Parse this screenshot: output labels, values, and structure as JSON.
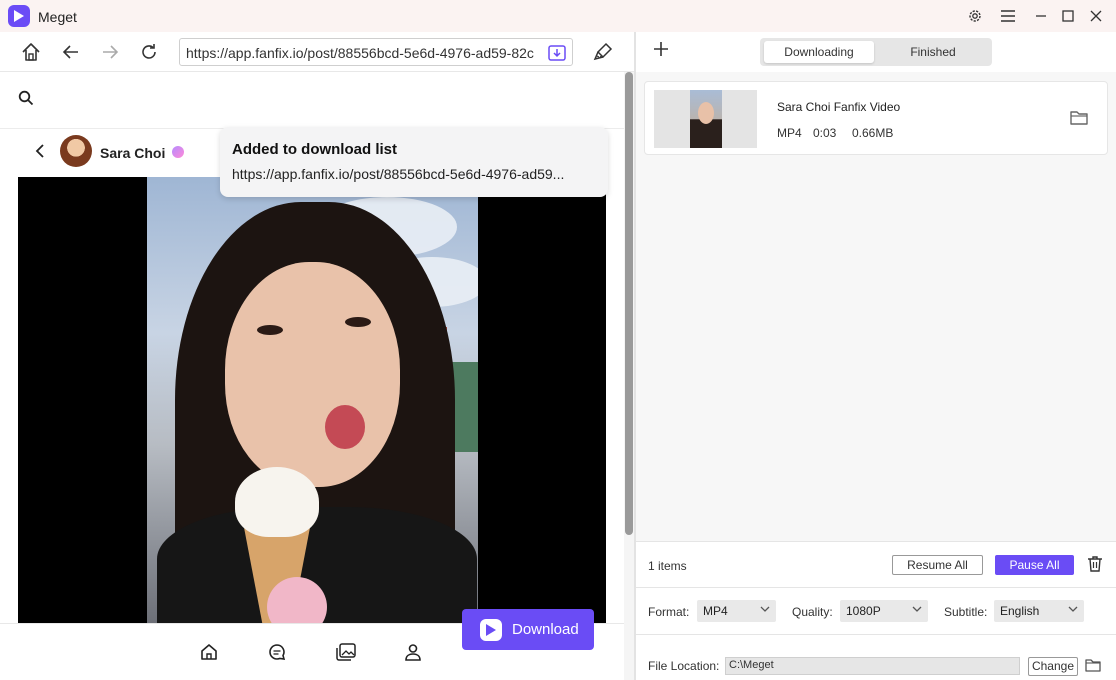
{
  "app": {
    "title": "Meget",
    "accent": "#6a4cf5"
  },
  "window_controls": {
    "settings_icon": "gear-icon",
    "menu_icon": "hamburger-icon",
    "minimize_icon": "minimize-icon",
    "maximize_icon": "maximize-icon",
    "close_icon": "close-icon"
  },
  "browser": {
    "url": "https://app.fanfix.io/post/88556bcd-5e6d-4976-ad59-82c"
  },
  "page": {
    "profile_name": "Sara Choi",
    "download_button": "Download"
  },
  "toast": {
    "title": "Added to download list",
    "url": "https://app.fanfix.io/post/88556bcd-5e6d-4976-ad59..."
  },
  "downloader": {
    "tabs": [
      "Downloading",
      "Finished"
    ],
    "active_tab": "Downloading",
    "item": {
      "title": "Sara Choi Fanfix Video",
      "format": "MP4",
      "duration": "0:03",
      "size": "0.66MB"
    },
    "footer": {
      "items_count": "1 items",
      "resume_all": "Resume All",
      "pause_all": "Pause All",
      "format_label": "Format:",
      "format_value": "MP4",
      "quality_label": "Quality:",
      "quality_value": "1080P",
      "subtitle_label": "Subtitle:",
      "subtitle_value": "English",
      "location_label": "File Location:",
      "location_value": "C:\\Meget",
      "change_label": "Change"
    }
  }
}
